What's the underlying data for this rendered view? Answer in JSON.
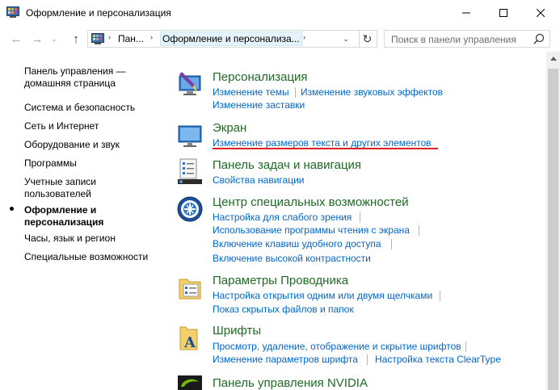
{
  "window": {
    "title": "Оформление и персонализация",
    "minimize_label": "—",
    "maximize_label": "☐",
    "close_label": "✕"
  },
  "nav": {
    "back_glyph": "←",
    "forward_glyph": "→",
    "recent_glyph": "⌄",
    "up_glyph": "↑",
    "breadcrumb_1": "Пан...",
    "breadcrumb_2": "Оформление и персонализа...",
    "breadcrumb_sep": "›",
    "dropdown_glyph": "⌄",
    "refresh_glyph": "↻",
    "search_placeholder": "Поиск в панели управления"
  },
  "sidebar": {
    "items": [
      {
        "label_line1": "Панель управления —",
        "label_line2": "домашняя страница"
      },
      {
        "label_line1": "Система и безопасность"
      },
      {
        "label_line1": "Сеть и Интернет"
      },
      {
        "label_line1": "Оборудование и звук"
      },
      {
        "label_line1": "Программы"
      },
      {
        "label_line1": "Учетные записи",
        "label_line2": "пользователей"
      },
      {
        "label_line1": "Оформление и",
        "label_line2": "персонализация"
      },
      {
        "label_line1": "Часы, язык и регион"
      },
      {
        "label_line1": "Специальные возможности"
      }
    ]
  },
  "categories": {
    "personalization": {
      "title": "Персонализация",
      "links": [
        "Изменение темы",
        "Изменение звуковых эффектов",
        "Изменение заставки"
      ]
    },
    "display": {
      "title": "Экран",
      "links": [
        "Изменение размеров текста и других элементов"
      ]
    },
    "taskbar": {
      "title": "Панель задач и навигация",
      "links": [
        "Свойства навигации"
      ]
    },
    "ease": {
      "title": "Центр специальных возможностей",
      "links": [
        "Настройка для слабого зрения",
        "Использование программы чтения с экрана",
        "Включение клавиш удобного доступа",
        "Включение высокой контрастности"
      ]
    },
    "explorer": {
      "title": "Параметры Проводника",
      "links": [
        "Настройка открытия одним или двумя щелчками",
        "Показ скрытых файлов и папок"
      ]
    },
    "fonts": {
      "title": "Шрифты",
      "links": [
        "Просмотр, удаление, отображение и скрытие шрифтов",
        "Изменение параметров шрифта",
        "Настройка текста ClearType"
      ]
    },
    "nvidia": {
      "title": "Панель управления NVIDIA"
    }
  },
  "colors": {
    "category_title": "#1e6b23",
    "link": "#0066cc",
    "highlight_underline": "#e01e25"
  }
}
